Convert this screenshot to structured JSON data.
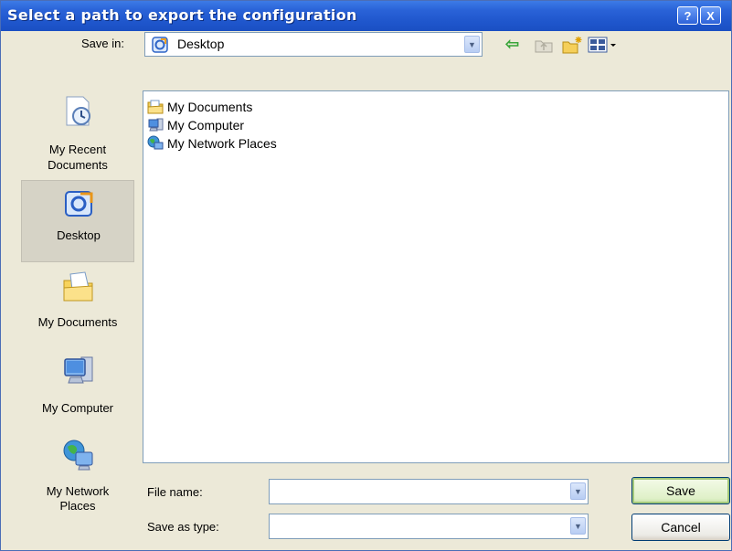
{
  "window": {
    "title": "Select a path to export the configuration",
    "help_glyph": "?",
    "close_glyph": "X"
  },
  "toolbar": {
    "save_in_label": "Save in:",
    "location": "Desktop",
    "back_glyph": "⇦"
  },
  "places": [
    {
      "label_line1": "My Recent",
      "label_line2": "Documents",
      "icon": "recent-documents-icon"
    },
    {
      "label_line1": "Desktop",
      "label_line2": "",
      "icon": "desktop-icon"
    },
    {
      "label_line1": "My Documents",
      "label_line2": "",
      "icon": "my-documents-icon"
    },
    {
      "label_line1": "My Computer",
      "label_line2": "",
      "icon": "my-computer-icon"
    },
    {
      "label_line1": "My Network",
      "label_line2": "Places",
      "icon": "network-places-icon"
    }
  ],
  "files": [
    {
      "name": "My Documents",
      "icon": "folder-icon"
    },
    {
      "name": "My Computer",
      "icon": "computer-icon"
    },
    {
      "name": "My Network Places",
      "icon": "network-icon"
    }
  ],
  "bottom": {
    "file_name_label": "File name:",
    "file_name_value": "",
    "save_as_type_label": "Save as type:",
    "save_as_type_value": ""
  },
  "buttons": {
    "save": "Save",
    "cancel": "Cancel"
  },
  "colors": {
    "titlebar": "#2a63d8",
    "dialog_bg": "#ece9d8",
    "selected_place": "#d6d3c6"
  }
}
